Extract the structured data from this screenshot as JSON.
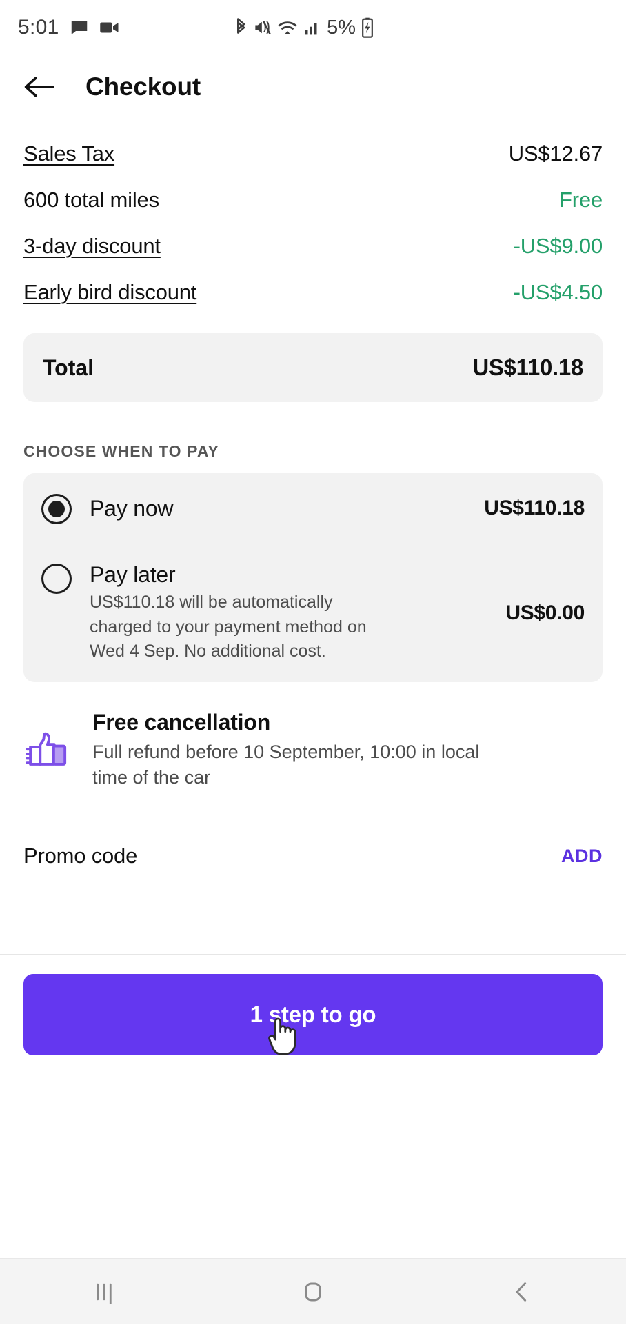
{
  "status_bar": {
    "time": "5:01",
    "battery_percent": "5%",
    "icons_left": [
      "message-icon",
      "video-camera-icon"
    ],
    "icons_right": [
      "bluetooth-icon",
      "mute-icon",
      "wifi-icon",
      "cellular-signal-icon",
      "battery-charging-icon"
    ]
  },
  "app_bar": {
    "back_icon": "back-arrow-icon",
    "title": "Checkout"
  },
  "price_rows": [
    {
      "label": "Sales Tax",
      "value": "US$12.67",
      "link": true,
      "green": false
    },
    {
      "label": "600 total miles",
      "value": "Free",
      "link": false,
      "green": true
    },
    {
      "label": "3-day discount",
      "value": "-US$9.00",
      "link": true,
      "green": true
    },
    {
      "label": "Early bird discount",
      "value": "-US$4.50",
      "link": true,
      "green": true
    }
  ],
  "total": {
    "label": "Total",
    "value": "US$110.18"
  },
  "pay_section": {
    "heading": "CHOOSE WHEN TO PAY",
    "options": [
      {
        "title": "Pay now",
        "description": "",
        "price": "US$110.18",
        "selected": true
      },
      {
        "title": "Pay later",
        "description": "US$110.18 will be automatically charged to your payment method on Wed 4 Sep. No additional cost.",
        "price": "US$0.00",
        "selected": false
      }
    ]
  },
  "cancellation": {
    "icon": "thumbs-up-icon",
    "title": "Free cancellation",
    "description": "Full refund before 10 September, 10:00 in local time of the car"
  },
  "promo": {
    "label": "Promo code",
    "add_label": "ADD"
  },
  "cta": {
    "label": "1 step to go"
  },
  "nav_bar": {
    "recents": "recents-icon",
    "home": "home-icon",
    "back": "back-icon"
  },
  "colors": {
    "accent_purple": "#6437f0",
    "link_purple": "#5b31e0",
    "green": "#24a06a",
    "card_gray": "#f2f2f2"
  }
}
